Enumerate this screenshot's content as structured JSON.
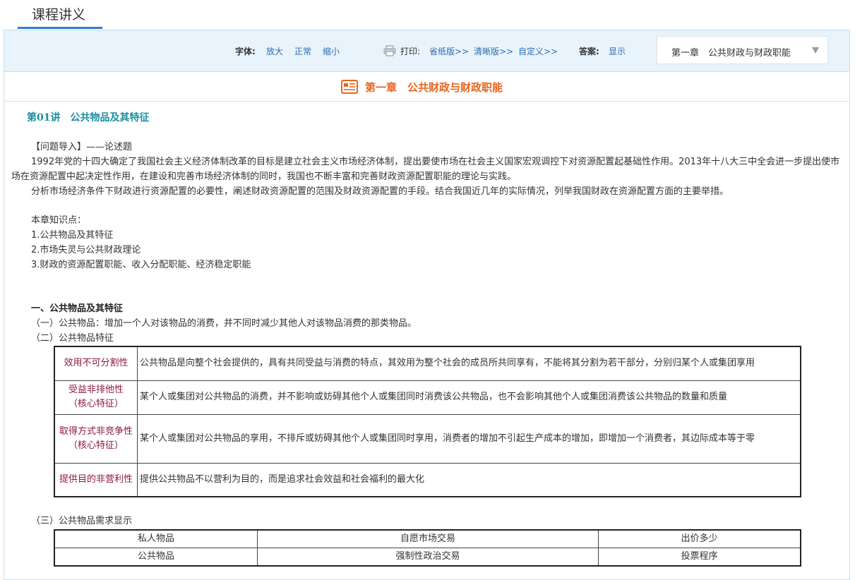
{
  "tab": {
    "title": "课程讲义"
  },
  "toolbar": {
    "font_label": "字体:",
    "font_options": [
      "放大",
      "正常",
      "缩小"
    ],
    "print_label": "打印:",
    "print_options": [
      "省纸版>>",
      "清晰版>>",
      "自定义>>"
    ],
    "answer_label": "答案:",
    "answer_option": "显示",
    "chapter_select": "第一章　公共财政与财政职能"
  },
  "chapter": {
    "title": "第一章　公共财政与财政职能"
  },
  "lecture": {
    "title": "第01讲　公共物品及其特征"
  },
  "content": {
    "intro_heading": "【问题导入】——论述题",
    "intro_p1": "1992年党的十四大确定了我国社会主义经济体制改革的目标是建立社会主义市场经济体制，提出要使市场在社会主义国家宏观调控下对资源配置起基础性作用。2013年十八大三中全会进一步提出使市场在资源配置中起决定性作用，在建设和完善市场经济体制的同时，我国也不断丰富和完善财政资源配置职能的理论与实践。",
    "intro_p2": "分析市场经济条件下财政进行资源配置的必要性，阐述财政资源配置的范围及财政资源配置的手段。结合我国近几年的实际情况，列举我国财政在资源配置方面的主要举措。",
    "knowledge_heading": "本章知识点：",
    "knowledge_points": [
      "1.公共物品及其特征",
      "2.市场失灵与公共财政理论",
      "3.财政的资源配置职能、收入分配职能、经济稳定职能"
    ],
    "section1_heading": "一、公共物品及其特征",
    "sub1": "（一）公共物品：增加一个人对该物品的消费，并不同时减少其他人对该物品消费的那类物品。",
    "sub2": "（二）公共物品特征",
    "features": [
      {
        "key_lines": [
          "效用不可分割性"
        ],
        "desc": "公共物品是向整个社会提供的，具有共同受益与消费的特点，其效用为整个社会的成员所共同享有，不能将其分割为若干部分，分别归某个人或集团享用"
      },
      {
        "key_lines": [
          "受益非排他性",
          "（核心特征）"
        ],
        "desc": "某个人或集团对公共物品的消费，并不影响或妨碍其他个人或集团同时消费该公共物品，也不会影响其他个人或集团消费该公共物品的数量和质量"
      },
      {
        "key_lines": [
          "取得方式非竞争性",
          "（核心特征）"
        ],
        "desc": "某个人或集团对公共物品的享用，不排斥或妨碍其他个人或集团同时享用，消费者的增加不引起生产成本的增加，即增加一个消费者，其边际成本等于零"
      },
      {
        "key_lines": [
          "提供目的非营利性"
        ],
        "desc": "提供公共物品不以营利为目的，而是追求社会效益和社会福利的最大化"
      }
    ],
    "sub3": "（三）公共物品需求显示",
    "demand_rows": [
      [
        "私人物品",
        "自愿市场交易",
        "出价多少"
      ],
      [
        "公共物品",
        "强制性政治交易",
        "投票程序"
      ]
    ]
  }
}
